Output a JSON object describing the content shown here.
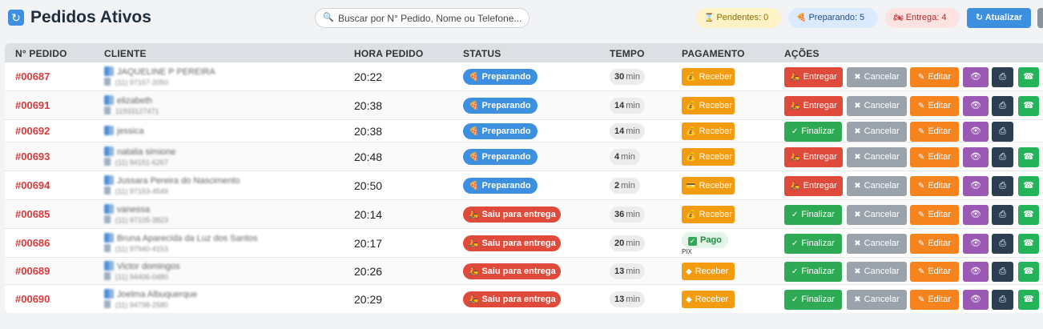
{
  "header": {
    "title": "Pedidos Ativos",
    "title_icon": "refresh-icon",
    "search_placeholder": "Buscar por N° Pedido, Nome ou Telefone...",
    "counters": {
      "pendentes": "Pendentes: 0",
      "preparando": "Preparando: 5",
      "entrega": "Entrega: 4"
    },
    "refresh_label": "Atualizar"
  },
  "table": {
    "columns": [
      "N° PEDIDO",
      "CLIENTE",
      "HORA PEDIDO",
      "STATUS",
      "TEMPO",
      "PAGAMENTO",
      "AÇÕES"
    ],
    "rows": [
      {
        "id": "#00687",
        "client": "JAQUELINE P PEREIRA",
        "phone": "(11) 97157-2050",
        "time": "20:22",
        "status": "Preparando",
        "status_type": "prep",
        "tempo": "30",
        "tempo_unit": "min",
        "payment": "Receber",
        "payment_type": "receber",
        "primary_action": "Entregar",
        "actions": [
          "Cancelar",
          "Editar"
        ],
        "whatsapp": true
      },
      {
        "id": "#00691",
        "client": "elizabeth",
        "phone": "11933127471",
        "time": "20:38",
        "status": "Preparando",
        "status_type": "prep",
        "tempo": "14",
        "tempo_unit": "min",
        "payment": "Receber",
        "payment_type": "receber",
        "primary_action": "Entregar",
        "actions": [
          "Cancelar",
          "Editar"
        ],
        "whatsapp": true
      },
      {
        "id": "#00692",
        "client": "jessica",
        "phone": "",
        "time": "20:38",
        "status": "Preparando",
        "status_type": "prep",
        "tempo": "14",
        "tempo_unit": "min",
        "payment": "Receber",
        "payment_type": "receber",
        "primary_action": "Finalizar",
        "actions": [
          "Cancelar",
          "Editar"
        ],
        "whatsapp": false
      },
      {
        "id": "#00693",
        "client": "natalia simione",
        "phone": "(11) 94151-6267",
        "time": "20:48",
        "status": "Preparando",
        "status_type": "prep",
        "tempo": "4",
        "tempo_unit": "min",
        "payment": "Receber",
        "payment_type": "receber",
        "primary_action": "Entregar",
        "actions": [
          "Cancelar",
          "Editar"
        ],
        "whatsapp": true
      },
      {
        "id": "#00694",
        "client": "Jussara Pereira do Nascimento",
        "phone": "(11) 97153-4549",
        "time": "20:50",
        "status": "Preparando",
        "status_type": "prep",
        "tempo": "2",
        "tempo_unit": "min",
        "payment": "Receber",
        "payment_type": "cartao",
        "primary_action": "Entregar",
        "actions": [
          "Cancelar",
          "Editar"
        ],
        "whatsapp": true
      },
      {
        "id": "#00685",
        "client": "vanessa",
        "phone": "(11) 97105-3823",
        "time": "20:14",
        "status": "Saiu para entrega",
        "status_type": "saiu",
        "tempo": "36",
        "tempo_unit": "min",
        "payment": "Receber",
        "payment_type": "receber",
        "primary_action": "Finalizar",
        "actions": [
          "Cancelar",
          "Editar"
        ],
        "whatsapp": true
      },
      {
        "id": "#00686",
        "client": "Bruna Aparecida da Luz dos Santos",
        "phone": "(11) 97940-4153",
        "time": "20:17",
        "status": "Saiu para entrega",
        "status_type": "saiu",
        "tempo": "20",
        "tempo_unit": "min",
        "payment": "Pago",
        "payment_type": "pago",
        "payment_method": "PIX",
        "primary_action": "Finalizar",
        "actions": [
          "Cancelar",
          "Editar"
        ],
        "whatsapp": true
      },
      {
        "id": "#00689",
        "client": "Victor domingos",
        "phone": "(11) 94406-0480",
        "time": "20:26",
        "status": "Saiu para entrega",
        "status_type": "saiu",
        "tempo": "13",
        "tempo_unit": "min",
        "payment": "Receber",
        "payment_type": "pix",
        "primary_action": "Finalizar",
        "actions": [
          "Cancelar",
          "Editar"
        ],
        "whatsapp": true
      },
      {
        "id": "#00690",
        "client": "Joelma Albuquerque",
        "phone": "(11) 94798-2580",
        "time": "20:29",
        "status": "Saiu para entrega",
        "status_type": "saiu",
        "tempo": "13",
        "tempo_unit": "min",
        "payment": "Receber",
        "payment_type": "pix",
        "primary_action": "Finalizar",
        "actions": [
          "Cancelar",
          "Editar"
        ],
        "whatsapp": true
      }
    ]
  },
  "colors": {
    "primary": "#3d8fe0",
    "danger": "#e04a3a",
    "success": "#2eaa55",
    "warning": "#f39c12",
    "edit": "#f5841f",
    "view": "#9b59b6",
    "print": "#2c3e50"
  }
}
